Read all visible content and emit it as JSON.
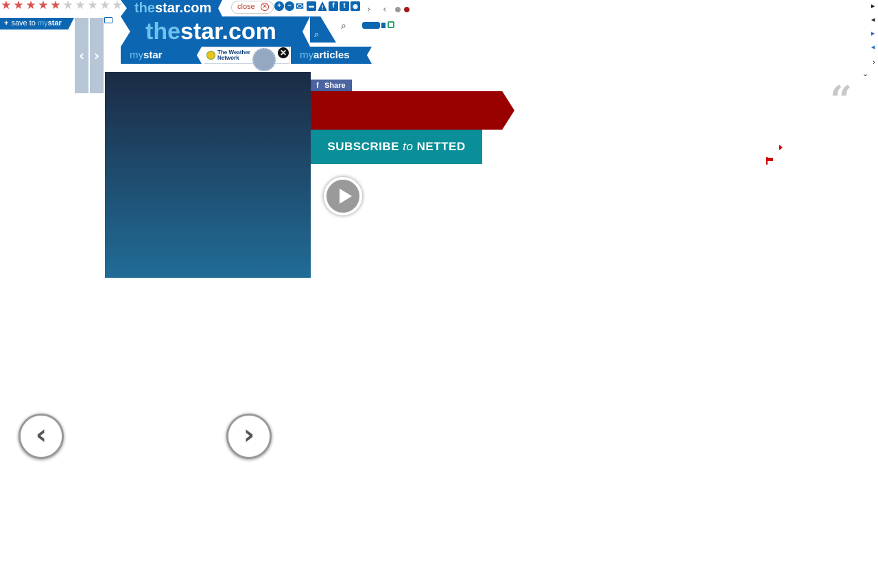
{
  "rating": {
    "filled": 5,
    "total": 10,
    "glyph": "★"
  },
  "save": {
    "plus": "+",
    "prefix": "save to",
    "my": "my",
    "star": "star"
  },
  "side_arrows": {
    "left": "‹",
    "right": "›"
  },
  "logo": {
    "the": "the",
    "star": "star",
    "dotcom": ".com"
  },
  "close_pill": {
    "label": "close",
    "x": "✕"
  },
  "toolbar": {
    "zoom_in": "+",
    "zoom_out": "−",
    "email": "✉",
    "print": "▬",
    "alert": "!",
    "facebook": "f",
    "twitter": "t",
    "rss": "◉",
    "next": "›",
    "prev": "‹"
  },
  "search": {
    "icon": "⌕"
  },
  "nav": {
    "my": "my",
    "star": "star",
    "articles": "articles",
    "weather": "The Weather Network",
    "weather_line1": "The Weather",
    "weather_line2": "Network",
    "close_x": "✕"
  },
  "share": {
    "f": "f",
    "label": "Share"
  },
  "subscribe": {
    "pre": "SUBSCRIBE ",
    "to": "to",
    "post": " NETTED"
  },
  "quote": {
    "mark": "“"
  },
  "right_arrows": [
    "▸",
    "◂",
    "▸",
    "◂",
    "›",
    "⌄"
  ],
  "gallery": {
    "prev": "‹",
    "next": "›"
  },
  "colors": {
    "brand_blue": "#0d66b1",
    "brand_light": "#6fc2ee",
    "red": "#990000",
    "teal": "#0a8f98",
    "star_on": "#d9534f",
    "star_off": "#cccccc"
  },
  "icons": [
    "star-icon",
    "chat-icon",
    "search-icon",
    "magnifier-icon",
    "camera-icon",
    "lock-icon",
    "play-icon",
    "flag-icon",
    "quote-icon",
    "close-icon"
  ]
}
